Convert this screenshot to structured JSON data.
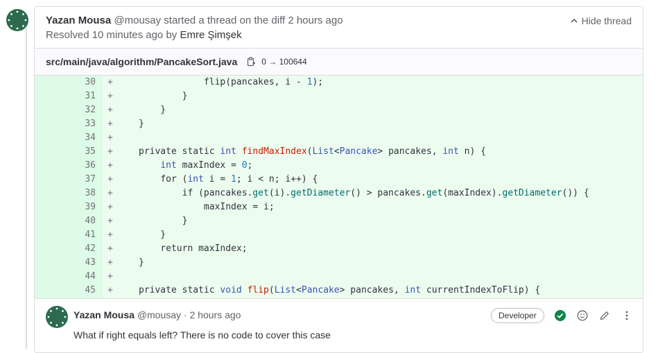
{
  "thread": {
    "author_name": "Yazan Mousa",
    "author_handle": "@mousay",
    "action_text": "started a thread on the diff",
    "time": "2 hours ago",
    "resolved_prefix": "Resolved 10 minutes ago by",
    "resolver": "Emre Şimşek",
    "hide_label": "Hide thread"
  },
  "file": {
    "path": "src/main/java/algorithm/PancakeSort.java",
    "mode_change": "0 → 100644"
  },
  "diff_lines": [
    {
      "num": "30",
      "marker": "+",
      "text": "            flip(pancakes, i - 1);"
    },
    {
      "num": "31",
      "marker": "+",
      "text": "        }"
    },
    {
      "num": "32",
      "marker": "+",
      "text": "    }"
    },
    {
      "num": "33",
      "marker": "+",
      "text": "}"
    },
    {
      "num": "34",
      "marker": "+",
      "text": ""
    },
    {
      "num": "35",
      "marker": "+",
      "text": "private static int findMaxIndex(List<Pancake> pancakes, int n) {"
    },
    {
      "num": "36",
      "marker": "+",
      "text": "    int maxIndex = 0;"
    },
    {
      "num": "37",
      "marker": "+",
      "text": "    for (int i = 1; i < n; i++) {"
    },
    {
      "num": "38",
      "marker": "+",
      "text": "        if (pancakes.get(i).getDiameter() > pancakes.get(maxIndex).getDiameter()) {"
    },
    {
      "num": "39",
      "marker": "+",
      "text": "            maxIndex = i;"
    },
    {
      "num": "40",
      "marker": "+",
      "text": "        }"
    },
    {
      "num": "41",
      "marker": "+",
      "text": "    }"
    },
    {
      "num": "42",
      "marker": "+",
      "text": "    return maxIndex;"
    },
    {
      "num": "43",
      "marker": "+",
      "text": "}"
    },
    {
      "num": "44",
      "marker": "+",
      "text": ""
    },
    {
      "num": "45",
      "marker": "+",
      "text": "private static void flip(List<Pancake> pancakes, int currentIndexToFlip) {"
    }
  ],
  "comment": {
    "author_name": "Yazan Mousa",
    "author_handle": "@mousay",
    "separator": "·",
    "time": "2 hours ago",
    "role": "Developer",
    "body": "What if right equals left? There is no code to cover this case"
  },
  "icons": [
    "avatar",
    "chevron-up-icon",
    "copy-icon",
    "resolve-check-icon",
    "emoji-icon",
    "edit-pencil-icon",
    "more-actions-icon"
  ],
  "colors": {
    "added_bg": "#ecfdf0",
    "added_gutter": "#ddfbe6",
    "resolved_green": "#108548",
    "type_blue": "#3a52b3",
    "fn_red": "#c91c00"
  }
}
